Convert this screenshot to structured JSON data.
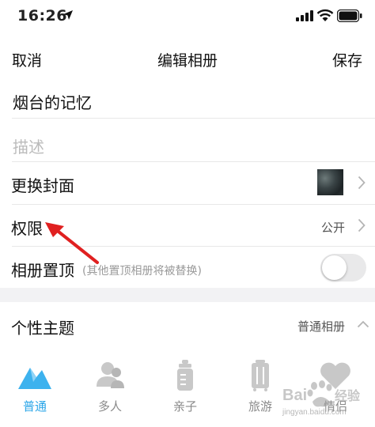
{
  "status_bar": {
    "time": "16:26"
  },
  "nav": {
    "cancel": "取消",
    "title": "编辑相册",
    "save": "保存"
  },
  "album": {
    "name": "烟台的记忆",
    "description_placeholder": "描述"
  },
  "settings": {
    "cover_label": "更换封面",
    "permission_label": "权限",
    "permission_value": "公开",
    "pin_label": "相册置顶",
    "pin_hint": "(其他置顶相册将被替换)",
    "pin_enabled": false
  },
  "theme": {
    "label": "个性主题",
    "value": "普通相册",
    "options": [
      "普通",
      "多人",
      "亲子",
      "旅游",
      "情侣"
    ],
    "selected": "普通"
  },
  "watermark": {
    "text": "Baidu经验",
    "url": "jingyan.baidu.com"
  },
  "colors": {
    "accent": "#2ba6e8",
    "arrow": "#e02020"
  }
}
